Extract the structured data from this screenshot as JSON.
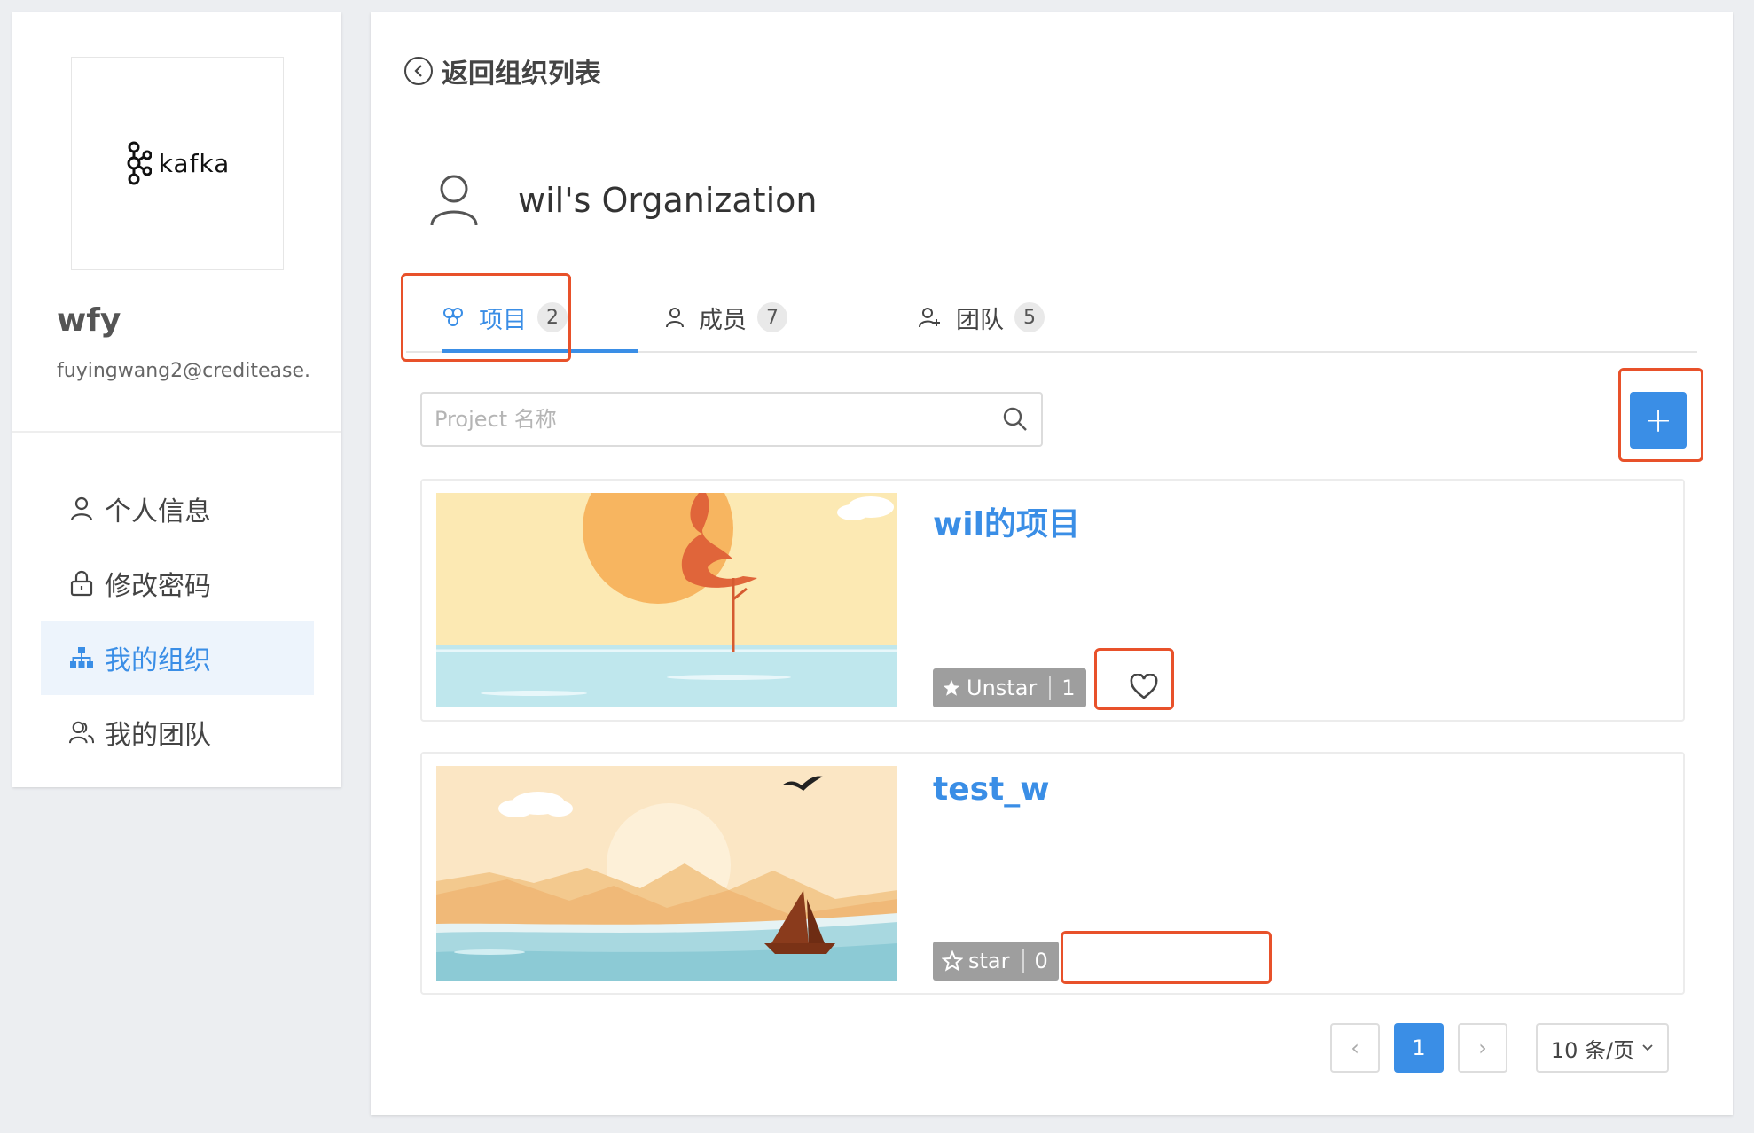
{
  "sidebar": {
    "logo_text": "kafka",
    "user_name": "wfy",
    "user_email": "fuyingwang2@creditease.",
    "menu": [
      {
        "label": "个人信息",
        "icon": "user-icon",
        "active": false
      },
      {
        "label": "修改密码",
        "icon": "lock-icon",
        "active": false
      },
      {
        "label": "我的组织",
        "icon": "org-tree-icon",
        "active": true
      },
      {
        "label": "我的团队",
        "icon": "team-icon",
        "active": false
      }
    ]
  },
  "main": {
    "back_label": "返回组织列表",
    "org_name": "wil's Organization",
    "tabs": [
      {
        "label": "项目",
        "count": "2",
        "icon": "project-icon",
        "active": true
      },
      {
        "label": "成员",
        "count": "7",
        "icon": "member-icon",
        "active": false
      },
      {
        "label": "团队",
        "count": "5",
        "icon": "team-add-icon",
        "active": false
      }
    ],
    "search_placeholder": "Project 名称",
    "add_button": "+",
    "projects": [
      {
        "name": "wil的项目",
        "star_label": "Unstar",
        "star_count": "1",
        "starred": true,
        "image": "flamingo-sunset"
      },
      {
        "name": "test_w",
        "star_label": "star",
        "star_count": "0",
        "starred": false,
        "image": "desert-sailboat"
      }
    ],
    "pagination": {
      "prev": "‹",
      "current": "1",
      "next": "›",
      "page_size": "10 条/页"
    }
  },
  "colors": {
    "accent": "#3a8ee6",
    "highlight": "#e8512a",
    "star_bg": "#9e9e9e",
    "active_menu_bg": "#edf4fc"
  }
}
